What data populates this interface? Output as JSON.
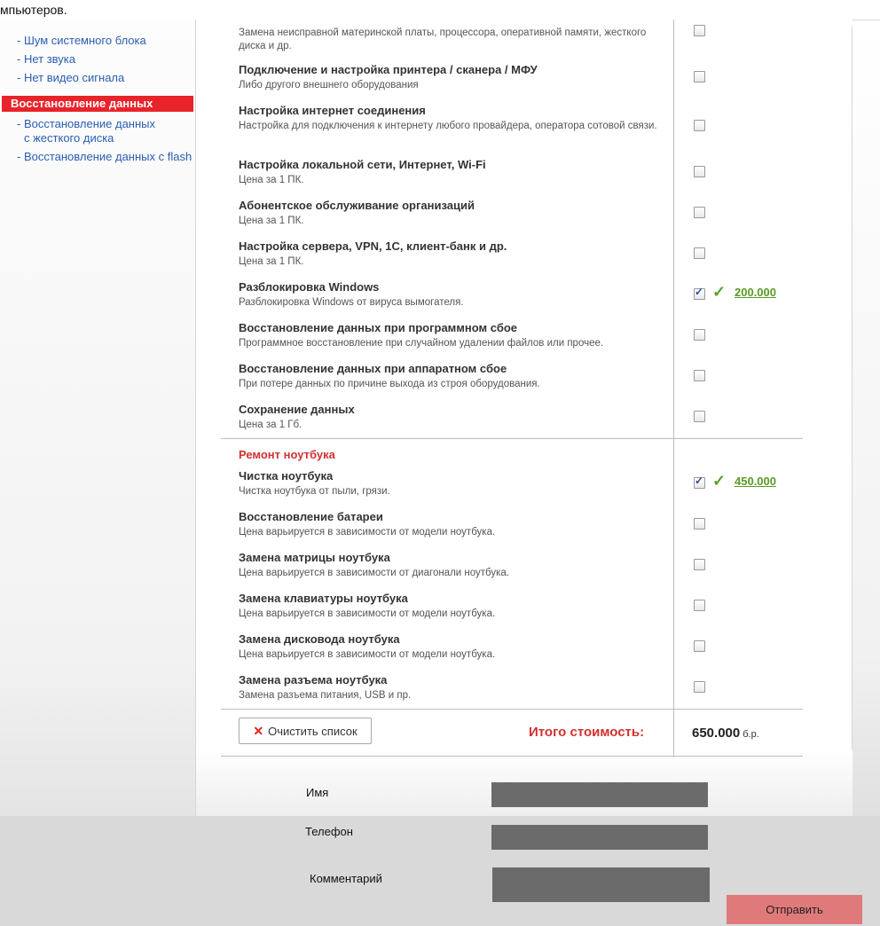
{
  "header": {
    "text_fragment": "мпьютеров."
  },
  "sidebar": {
    "links_top": [
      {
        "label": "- Шум системного блока"
      },
      {
        "label": "- Нет звука"
      },
      {
        "label": "- Нет видео сигнала"
      }
    ],
    "section_head": "Восстановление данных",
    "links_bottom": [
      {
        "label": "- Восстановление данных",
        "label2": "с жесткого диска"
      },
      {
        "label": "- Восстановление данных с flash"
      }
    ]
  },
  "services": [
    {
      "title": "",
      "desc": "Замена неисправной материнской платы, процессора, оперативной памяти, жесткого диска и др.",
      "checked": false
    },
    {
      "title": "Подключение и настройка принтера / сканера / МФУ",
      "desc": "Либо другого внешнего оборудования",
      "checked": false
    },
    {
      "title": "Настройка интернет соединения",
      "desc": "Настройка для подключения к интернету любого провайдера, оператора сотовой связи.",
      "checked": false
    },
    {
      "title": "Настройка локальной сети, Интернет, Wi-Fi",
      "desc": "Цена за 1 ПК.",
      "checked": false
    },
    {
      "title": "Абонентское обслуживание организаций",
      "desc": "Цена за 1 ПК.",
      "checked": false
    },
    {
      "title": "Настройка сервера, VPN, 1С, клиент-банк и др.",
      "desc": "Цена за 1 ПК.",
      "checked": false
    },
    {
      "title": "Разблокировка Windows",
      "desc": "Разблокировка Windows от вируса вымогателя.",
      "checked": true,
      "price": "200.000"
    },
    {
      "title": "Восстановление данных при программном сбое",
      "desc": "Программное восстановление при случайном удалении файлов или прочее.",
      "checked": false
    },
    {
      "title": "Восстановление данных при аппаратном сбое",
      "desc": "При потере данных по причине выхода из строя оборудования.",
      "checked": false
    },
    {
      "title": "Сохранение данных",
      "desc": "Цена за 1 Гб.",
      "checked": false
    }
  ],
  "laptop_section": {
    "title": "Ремонт ноутбука",
    "items": [
      {
        "title": "Чистка ноутбука",
        "desc": "Чистка ноутбука от пыли, грязи.",
        "checked": true,
        "price": "450.000"
      },
      {
        "title": "Восстановление батареи",
        "desc": "Цена варьируется в зависимости от модели ноутбука.",
        "checked": false
      },
      {
        "title": "Замена матрицы ноутбука",
        "desc": "Цена варьируется в зависимости от диагонали ноутбука.",
        "checked": false
      },
      {
        "title": "Замена клавиатуры ноутбука",
        "desc": "Цена варьируется в зависимости от модели ноутбука.",
        "checked": false
      },
      {
        "title": "Замена дисковода ноутбука",
        "desc": "Цена варьируется в зависимости от модели ноутбука.",
        "checked": false
      },
      {
        "title": "Замена разъема ноутбука",
        "desc": "Замена разъема питания, USB и пр.",
        "checked": false
      }
    ]
  },
  "footer": {
    "clear_label": "Очистить список",
    "total_label": "Итого стоимость:",
    "total_value": "650.000",
    "total_unit": "б.р."
  },
  "form": {
    "name_label": "Имя",
    "phone_label": "Телефон",
    "comment_label": "Комментарий",
    "submit_label": "Отправить"
  },
  "colors": {
    "accent_red": "#d23030",
    "price_green": "#5a9a23",
    "sidebar_head": "#e8232a",
    "submit_bg": "#e07a7a"
  }
}
